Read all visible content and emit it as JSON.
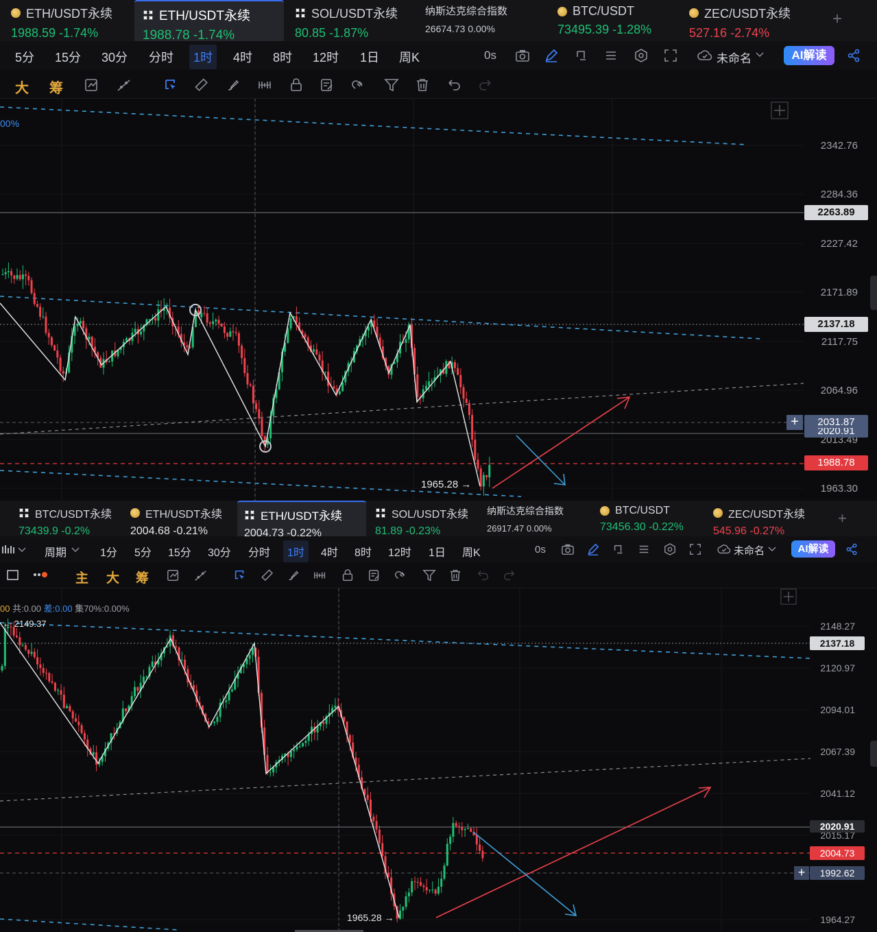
{
  "panel1": {
    "tabs": [
      {
        "icon": "coin",
        "name": "ETH/USDT永续",
        "price": "1988.59",
        "change": "-1.74%",
        "change_color": "#1fbf75"
      },
      {
        "icon": "exchange",
        "name": "ETH/USDT永续",
        "price": "1988.78",
        "change": "-1.74%",
        "change_color": "#1fbf75",
        "active": true
      },
      {
        "icon": "exchange",
        "name": "SOL/USDT永续",
        "price": "80.85",
        "change": "-1.87%",
        "change_color": "#1fbf75"
      },
      {
        "icon": "none",
        "name": "纳斯达克综合指数",
        "price": "26674.73",
        "change": "0.00%",
        "change_color": "#c9ccd1"
      },
      {
        "icon": "coin",
        "name": "BTC/USDT",
        "price": "73495.39",
        "change": "-1.28%",
        "change_color": "#1fbf75"
      },
      {
        "icon": "coin",
        "name": "ZEC/USDT永续",
        "price": "527.16",
        "change": "-2.74%",
        "change_color": "#f0424c"
      }
    ],
    "add_tab": "+",
    "timeframes": [
      "5分",
      "15分",
      "30分",
      "分时",
      "1时",
      "4时",
      "8时",
      "12时",
      "1日",
      "周K"
    ],
    "active_timeframe": "1时",
    "countdown": "0s",
    "layout_name": "未命名",
    "ai_label": "AI解读",
    "toolbar_cn": [
      "大",
      "筹"
    ],
    "price_labels": [
      "2342.76",
      "2284.36",
      "2227.42",
      "2171.89",
      "2117.75",
      "2064.96",
      "2013.49",
      "1963.30"
    ],
    "price_boxes": [
      {
        "value": "2263.89",
        "style": "grey"
      },
      {
        "value": "2137.18",
        "style": "grey"
      },
      {
        "value": "2031.87",
        "style": "blue"
      },
      {
        "value": "2020.91",
        "style": "blue"
      },
      {
        "value": "1988.78",
        "style": "red"
      }
    ],
    "low_annotation": "1965.28 →",
    "corner_text": "00%"
  },
  "panel2": {
    "tabs": [
      {
        "icon": "exchange",
        "name": "BTC/USDT永续",
        "price": "73439.9",
        "change": "-0.2%",
        "change_color": "#1fbf75"
      },
      {
        "icon": "coin",
        "name": "ETH/USDT永续",
        "price": "2004.68",
        "change": "-0.21%",
        "change_color": "#e6e7ea"
      },
      {
        "icon": "exchange",
        "name": "ETH/USDT永续",
        "price": "2004.73",
        "change": "-0.22%",
        "change_color": "#e6e7ea",
        "active": true
      },
      {
        "icon": "exchange",
        "name": "SOL/USDT永续",
        "price": "81.89",
        "change": "-0.23%",
        "change_color": "#1fbf75"
      },
      {
        "icon": "none",
        "name": "纳斯达克综合指数",
        "price": "26917.47",
        "change": "0.00%",
        "change_color": "#c9ccd1"
      },
      {
        "icon": "coin",
        "name": "BTC/USDT",
        "price": "73456.30",
        "change": "-0.22%",
        "change_color": "#1fbf75"
      },
      {
        "icon": "coin",
        "name": "ZEC/USDT永续",
        "price": "545.96",
        "change": "-0.27%",
        "change_color": "#f0424c"
      }
    ],
    "add_tab": "+",
    "period_label": "周期",
    "timeframes": [
      "1分",
      "5分",
      "15分",
      "30分",
      "分时",
      "1时",
      "4时",
      "8时",
      "12时",
      "1日",
      "周K"
    ],
    "active_timeframe": "1时",
    "countdown": "0s",
    "layout_name": "未命名",
    "ai_label": "AI解读",
    "toolbar_cn": [
      "主",
      "大",
      "筹"
    ],
    "info": {
      "lead": "00",
      "gong": "共:0.00",
      "cha": "差:0.00",
      "ji": "集70%:0.00%"
    },
    "price_labels": [
      "2148.27",
      "2120.97",
      "2094.01",
      "2067.39",
      "2041.12",
      "2015.17",
      "1964.27"
    ],
    "price_boxes": [
      {
        "value": "2137.18",
        "style": "grey"
      },
      {
        "value": "2020.91",
        "style": "grey"
      },
      {
        "value": "2004.73",
        "style": "red"
      },
      {
        "value": "1992.62",
        "style": "blue"
      }
    ],
    "high_annotation": "← 2149.37",
    "low_annotation": "1965.28 →"
  }
}
